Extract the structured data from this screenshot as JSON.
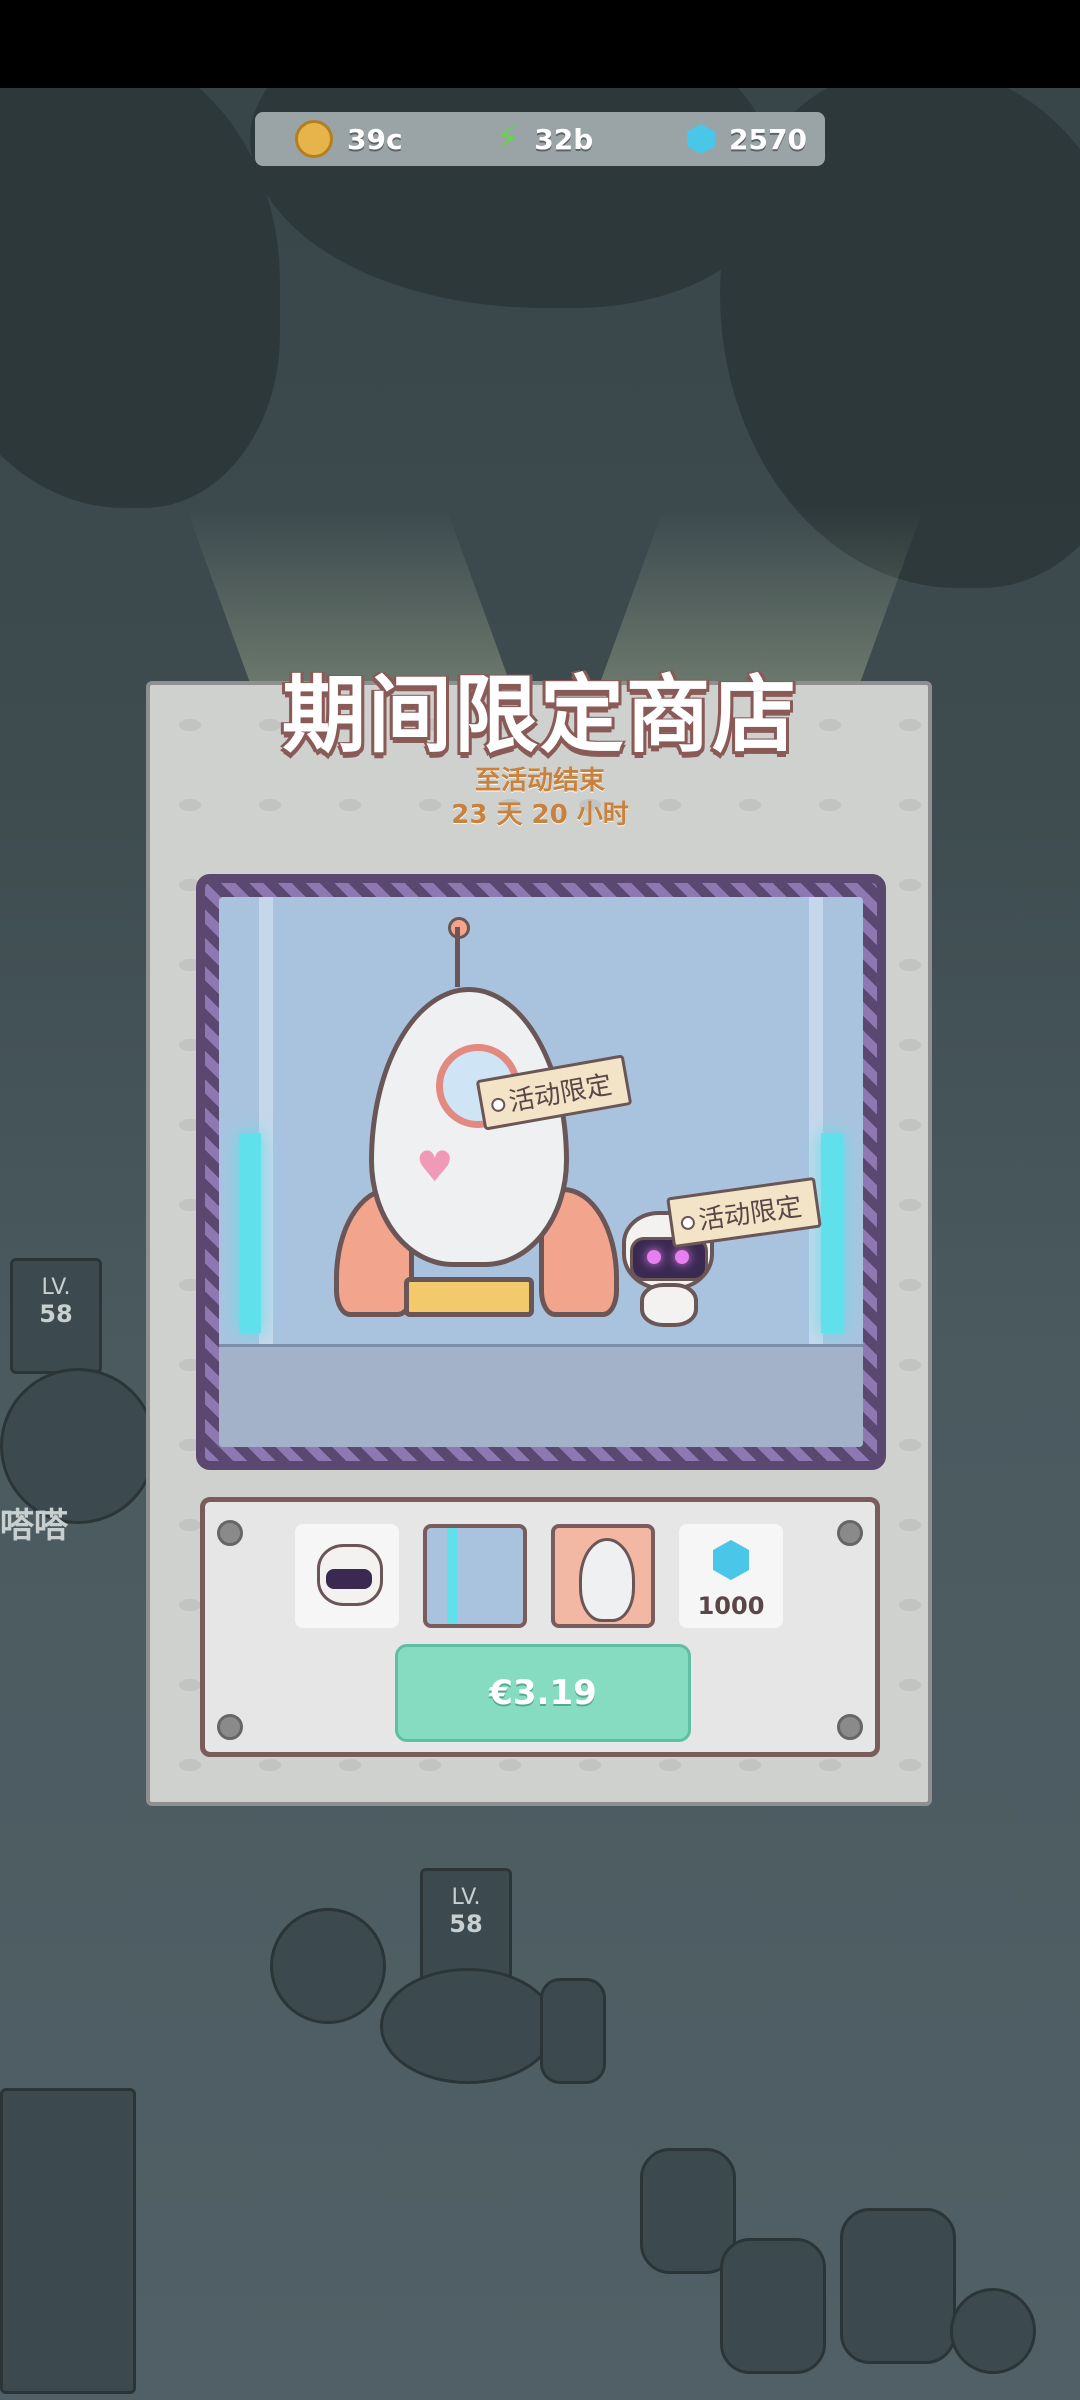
{
  "resources": {
    "coins": {
      "icon": "coin-icon",
      "value": "39c"
    },
    "energy": {
      "icon": "lightning-icon",
      "value": "32b"
    },
    "gems": {
      "icon": "gem-icon",
      "value": "2570"
    }
  },
  "scene": {
    "level_badge_1": "LV.",
    "level_value_1": "58",
    "level_badge_2": "LV.",
    "level_value_2": "58",
    "side_text": "嗒嗒"
  },
  "shop": {
    "title": "期间限定商店",
    "countdown_label": "至活动结束",
    "countdown_value": "23 天 20 小时",
    "tag_rocket": "活动限定",
    "tag_cat": "活动限定",
    "items": [
      {
        "name": "robot-cat-pet-item",
        "qty": ""
      },
      {
        "name": "background-item",
        "qty": ""
      },
      {
        "name": "rocket-item",
        "qty": ""
      },
      {
        "name": "gem-pack-item",
        "qty": "1000"
      }
    ],
    "price": "€3.19"
  },
  "colors": {
    "title_stroke": "#8a5a57",
    "countdown": "#c8823d",
    "buy_button": "#85dcc0",
    "frame": "#5a4870"
  }
}
